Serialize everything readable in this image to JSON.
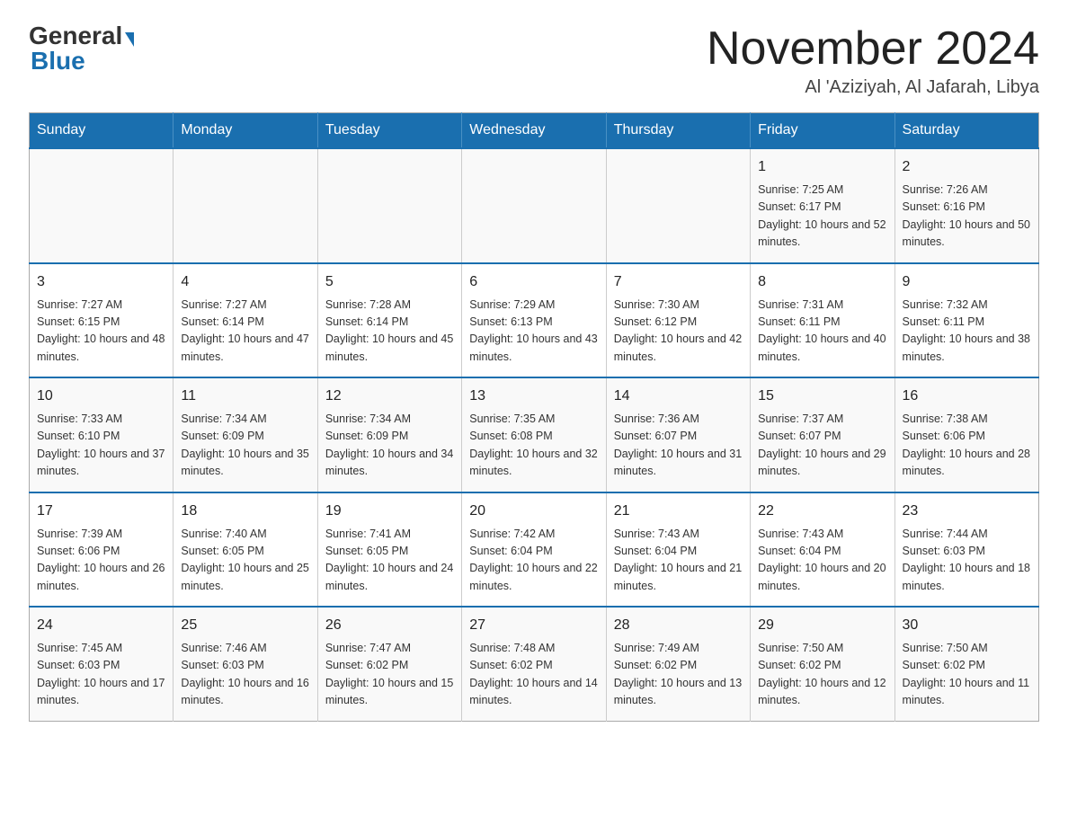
{
  "header": {
    "logo_general": "General",
    "logo_blue": "Blue",
    "month_title": "November 2024",
    "location": "Al 'Aziziyah, Al Jafarah, Libya"
  },
  "days_of_week": [
    "Sunday",
    "Monday",
    "Tuesday",
    "Wednesday",
    "Thursday",
    "Friday",
    "Saturday"
  ],
  "weeks": [
    {
      "days": [
        {
          "number": "",
          "info": ""
        },
        {
          "number": "",
          "info": ""
        },
        {
          "number": "",
          "info": ""
        },
        {
          "number": "",
          "info": ""
        },
        {
          "number": "",
          "info": ""
        },
        {
          "number": "1",
          "info": "Sunrise: 7:25 AM\nSunset: 6:17 PM\nDaylight: 10 hours and 52 minutes."
        },
        {
          "number": "2",
          "info": "Sunrise: 7:26 AM\nSunset: 6:16 PM\nDaylight: 10 hours and 50 minutes."
        }
      ]
    },
    {
      "days": [
        {
          "number": "3",
          "info": "Sunrise: 7:27 AM\nSunset: 6:15 PM\nDaylight: 10 hours and 48 minutes."
        },
        {
          "number": "4",
          "info": "Sunrise: 7:27 AM\nSunset: 6:14 PM\nDaylight: 10 hours and 47 minutes."
        },
        {
          "number": "5",
          "info": "Sunrise: 7:28 AM\nSunset: 6:14 PM\nDaylight: 10 hours and 45 minutes."
        },
        {
          "number": "6",
          "info": "Sunrise: 7:29 AM\nSunset: 6:13 PM\nDaylight: 10 hours and 43 minutes."
        },
        {
          "number": "7",
          "info": "Sunrise: 7:30 AM\nSunset: 6:12 PM\nDaylight: 10 hours and 42 minutes."
        },
        {
          "number": "8",
          "info": "Sunrise: 7:31 AM\nSunset: 6:11 PM\nDaylight: 10 hours and 40 minutes."
        },
        {
          "number": "9",
          "info": "Sunrise: 7:32 AM\nSunset: 6:11 PM\nDaylight: 10 hours and 38 minutes."
        }
      ]
    },
    {
      "days": [
        {
          "number": "10",
          "info": "Sunrise: 7:33 AM\nSunset: 6:10 PM\nDaylight: 10 hours and 37 minutes."
        },
        {
          "number": "11",
          "info": "Sunrise: 7:34 AM\nSunset: 6:09 PM\nDaylight: 10 hours and 35 minutes."
        },
        {
          "number": "12",
          "info": "Sunrise: 7:34 AM\nSunset: 6:09 PM\nDaylight: 10 hours and 34 minutes."
        },
        {
          "number": "13",
          "info": "Sunrise: 7:35 AM\nSunset: 6:08 PM\nDaylight: 10 hours and 32 minutes."
        },
        {
          "number": "14",
          "info": "Sunrise: 7:36 AM\nSunset: 6:07 PM\nDaylight: 10 hours and 31 minutes."
        },
        {
          "number": "15",
          "info": "Sunrise: 7:37 AM\nSunset: 6:07 PM\nDaylight: 10 hours and 29 minutes."
        },
        {
          "number": "16",
          "info": "Sunrise: 7:38 AM\nSunset: 6:06 PM\nDaylight: 10 hours and 28 minutes."
        }
      ]
    },
    {
      "days": [
        {
          "number": "17",
          "info": "Sunrise: 7:39 AM\nSunset: 6:06 PM\nDaylight: 10 hours and 26 minutes."
        },
        {
          "number": "18",
          "info": "Sunrise: 7:40 AM\nSunset: 6:05 PM\nDaylight: 10 hours and 25 minutes."
        },
        {
          "number": "19",
          "info": "Sunrise: 7:41 AM\nSunset: 6:05 PM\nDaylight: 10 hours and 24 minutes."
        },
        {
          "number": "20",
          "info": "Sunrise: 7:42 AM\nSunset: 6:04 PM\nDaylight: 10 hours and 22 minutes."
        },
        {
          "number": "21",
          "info": "Sunrise: 7:43 AM\nSunset: 6:04 PM\nDaylight: 10 hours and 21 minutes."
        },
        {
          "number": "22",
          "info": "Sunrise: 7:43 AM\nSunset: 6:04 PM\nDaylight: 10 hours and 20 minutes."
        },
        {
          "number": "23",
          "info": "Sunrise: 7:44 AM\nSunset: 6:03 PM\nDaylight: 10 hours and 18 minutes."
        }
      ]
    },
    {
      "days": [
        {
          "number": "24",
          "info": "Sunrise: 7:45 AM\nSunset: 6:03 PM\nDaylight: 10 hours and 17 minutes."
        },
        {
          "number": "25",
          "info": "Sunrise: 7:46 AM\nSunset: 6:03 PM\nDaylight: 10 hours and 16 minutes."
        },
        {
          "number": "26",
          "info": "Sunrise: 7:47 AM\nSunset: 6:02 PM\nDaylight: 10 hours and 15 minutes."
        },
        {
          "number": "27",
          "info": "Sunrise: 7:48 AM\nSunset: 6:02 PM\nDaylight: 10 hours and 14 minutes."
        },
        {
          "number": "28",
          "info": "Sunrise: 7:49 AM\nSunset: 6:02 PM\nDaylight: 10 hours and 13 minutes."
        },
        {
          "number": "29",
          "info": "Sunrise: 7:50 AM\nSunset: 6:02 PM\nDaylight: 10 hours and 12 minutes."
        },
        {
          "number": "30",
          "info": "Sunrise: 7:50 AM\nSunset: 6:02 PM\nDaylight: 10 hours and 11 minutes."
        }
      ]
    }
  ]
}
